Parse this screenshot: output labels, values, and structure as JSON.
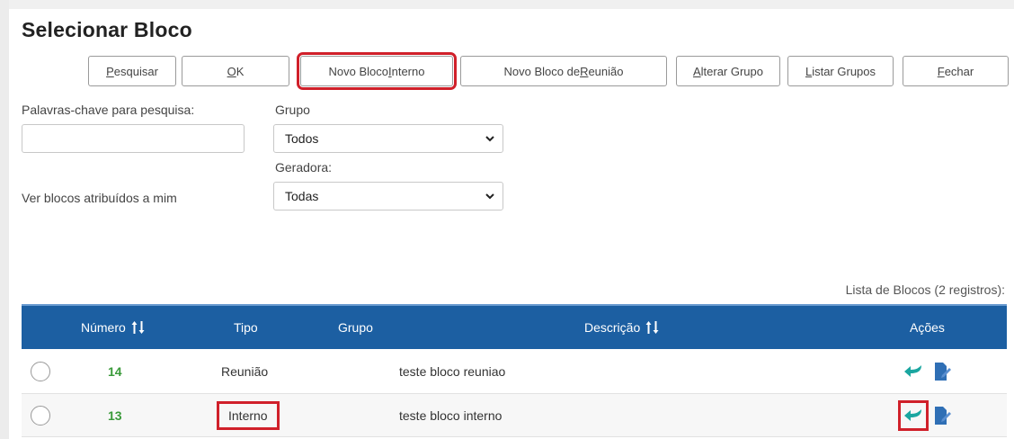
{
  "header": {
    "title": "Selecionar Bloco"
  },
  "toolbar": {
    "buttons": [
      {
        "pre": "",
        "u": "P",
        "post": "esquisar"
      },
      {
        "pre": "",
        "u": "O",
        "post": "K"
      },
      {
        "pre": "Novo Bloco ",
        "u": "I",
        "post": "nterno"
      },
      {
        "pre": "Novo Bloco de ",
        "u": "R",
        "post": "eunião"
      },
      {
        "pre": "",
        "u": "A",
        "post": "lterar Grupo"
      },
      {
        "pre": "",
        "u": "L",
        "post": "istar Grupos"
      },
      {
        "pre": "",
        "u": "F",
        "post": "echar"
      }
    ]
  },
  "filters": {
    "keywords_label": "Palavras-chave para pesquisa:",
    "keywords_value": "",
    "group_label": "Grupo",
    "group_value": "Todos",
    "generator_label": "Geradora:",
    "generator_value": "Todas",
    "assigned_label": "Ver blocos atribuídos a mim"
  },
  "list": {
    "caption": "Lista de Blocos (2 registros):",
    "columns": {
      "numero": "Número",
      "tipo": "Tipo",
      "grupo": "Grupo",
      "descricao": "Descrição",
      "acoes": "Ações"
    },
    "rows": [
      {
        "numero": "14",
        "tipo": "Reunião",
        "grupo": "",
        "descricao": "teste bloco reuniao"
      },
      {
        "numero": "13",
        "tipo": "Interno",
        "grupo": "",
        "descricao": "teste bloco interno"
      }
    ]
  },
  "colors": {
    "header_bg": "#1c5fa2",
    "highlight": "#d0202a",
    "number_green": "#3a9a3a",
    "action_teal": "#1aa6a0",
    "action_blue": "#2f6fb5"
  },
  "icons": {
    "action_include": "arrow-return-icon",
    "action_edit": "edit-document-icon",
    "sort": "sort-arrows-icon",
    "select": "chevron-down-icon"
  }
}
